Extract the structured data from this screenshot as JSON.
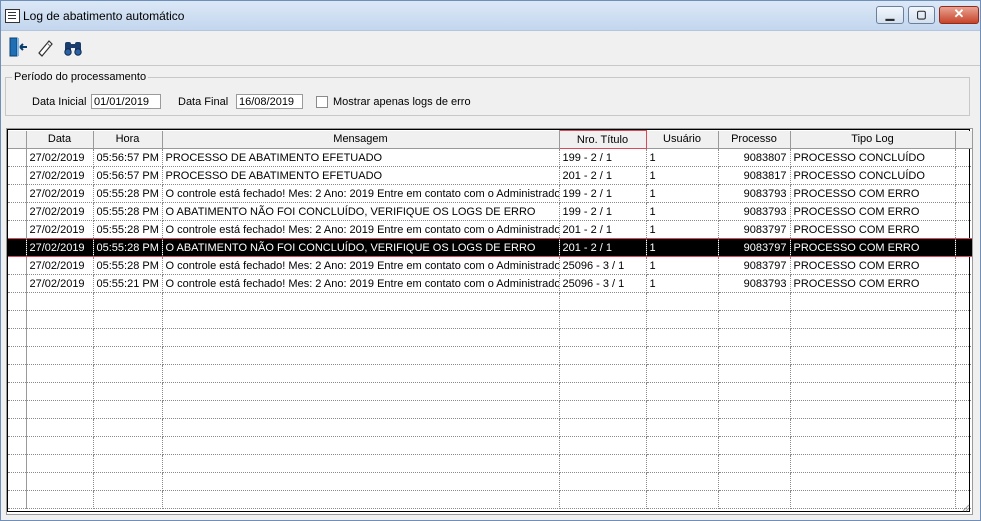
{
  "window": {
    "title": "Log de abatimento automático",
    "min_glyph": "▁",
    "max_glyph": "▢",
    "close_glyph": "✕"
  },
  "toolbar": {
    "icons": [
      "exit-door-icon",
      "eraser-icon",
      "binoculars-icon"
    ]
  },
  "period": {
    "legend": "Período do processamento",
    "start_label": "Data Inicial",
    "start_value": "01/01/2019",
    "end_label": "Data Final",
    "end_value": "16/08/2019",
    "errors_only_label": "Mostrar apenas logs de erro",
    "errors_only_checked": false
  },
  "grid": {
    "columns": [
      "Data",
      "Hora",
      "Mensagem",
      "Nro. Título",
      "Usuário",
      "Processo",
      "Tipo Log"
    ],
    "rows": [
      [
        "27/02/2019",
        "05:56:57 PM",
        "PROCESSO DE ABATIMENTO EFETUADO",
        "199 - 2 / 1",
        "1",
        "9083807",
        "PROCESSO CONCLUÍDO"
      ],
      [
        "27/02/2019",
        "05:56:57 PM",
        "PROCESSO DE ABATIMENTO EFETUADO",
        "201 - 2 / 1",
        "1",
        "9083817",
        "PROCESSO CONCLUÍDO"
      ],
      [
        "27/02/2019",
        "05:55:28 PM",
        " O controle está fechado! Mes: 2 Ano: 2019 Entre em contato com o Administrador",
        "199 - 2 / 1",
        "1",
        "9083793",
        "PROCESSO COM ERRO"
      ],
      [
        "27/02/2019",
        "05:55:28 PM",
        "O ABATIMENTO NÃO FOI CONCLUÍDO, VERIFIQUE OS LOGS DE ERRO",
        "199 - 2 / 1",
        "1",
        "9083793",
        "PROCESSO COM ERRO"
      ],
      [
        "27/02/2019",
        "05:55:28 PM",
        " O controle está fechado! Mes: 2 Ano: 2019 Entre em contato com o Administrador",
        "201 - 2 / 1",
        "1",
        "9083797",
        "PROCESSO COM ERRO"
      ],
      [
        "27/02/2019",
        "05:55:28 PM",
        "O ABATIMENTO NÃO FOI CONCLUÍDO, VERIFIQUE OS LOGS DE ERRO",
        "201 - 2 / 1",
        "1",
        "9083797",
        "PROCESSO COM ERRO"
      ],
      [
        "27/02/2019",
        "05:55:28 PM",
        " O controle está fechado! Mes: 2 Ano: 2019 Entre em contato com o Administrador",
        "25096 - 3 / 1",
        "1",
        "9083797",
        "PROCESSO COM ERRO"
      ],
      [
        "27/02/2019",
        "05:55:21 PM",
        " O controle está fechado! Mes: 2 Ano: 2019 Entre em contato com o Administrador",
        "25096 - 3 / 1",
        "1",
        "9083793",
        "PROCESSO COM ERRO"
      ]
    ],
    "selected_row": 5,
    "colors": {
      "selected_bg": "#000000",
      "selected_text": "#ffffff",
      "focus_border": "#d84a5a"
    }
  }
}
